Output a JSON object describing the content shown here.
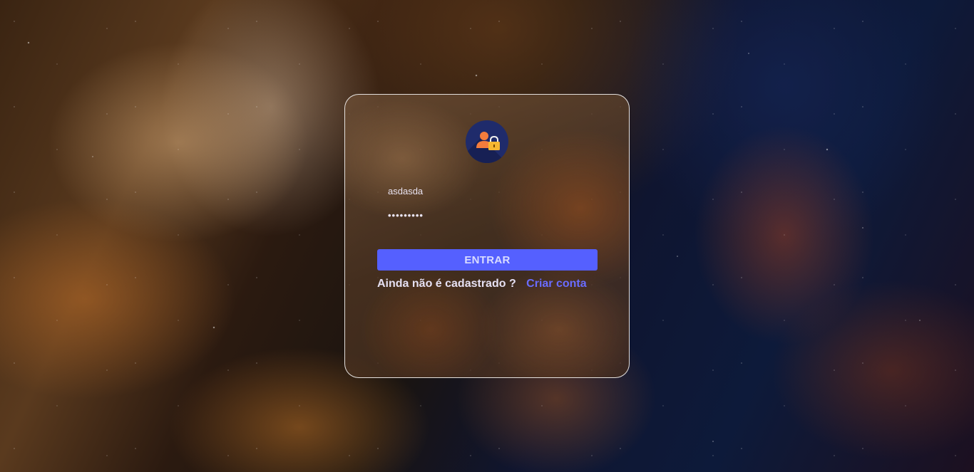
{
  "login": {
    "username_value": "asdasda",
    "password_value": "•••••••••",
    "enter_label": "ENTRAR",
    "signup_prompt": "Ainda não é cadastrado ?",
    "signup_link": "Criar conta"
  },
  "colors": {
    "button": "#5560ff",
    "link": "#6a6cff",
    "avatar_bg": "#1f2b6b"
  },
  "icons": {
    "avatar": "user-lock-icon"
  }
}
